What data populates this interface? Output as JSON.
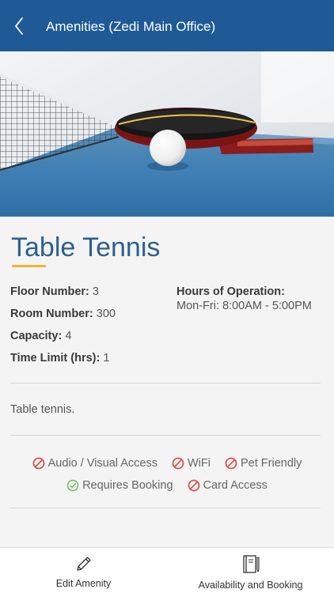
{
  "header": {
    "title": "Amenities (Zedi Main Office)",
    "back_icon": "chevron-left-icon",
    "color": "#1f5a96"
  },
  "hero": {
    "image": "table-tennis-paddle-and-ball-photo"
  },
  "amenity": {
    "name": "Table Tennis",
    "accent_color": "#f1b62b",
    "floor_label": "Floor Number:",
    "floor_value": "3",
    "room_label": "Room Number:",
    "room_value": "300",
    "capacity_label": "Capacity:",
    "capacity_value": "4",
    "time_limit_label": "Time Limit (hrs):",
    "time_limit_value": "1",
    "hours_label": "Hours of Operation:",
    "hours_value": "Mon-Fri: 8:00AM - 5:00PM",
    "description": "Table tennis."
  },
  "features": [
    {
      "label": "Audio / Visual Access",
      "available": false,
      "icon": "prohibited-icon"
    },
    {
      "label": "WiFi",
      "available": false,
      "icon": "prohibited-icon"
    },
    {
      "label": "Pet Friendly",
      "available": false,
      "icon": "prohibited-icon"
    },
    {
      "label": "Requires Booking",
      "available": true,
      "icon": "check-circle-icon"
    },
    {
      "label": "Card Access",
      "available": false,
      "icon": "prohibited-icon"
    }
  ],
  "feature_colors": {
    "unavailable": "#d9534f",
    "available": "#6fbf5a"
  },
  "bottom_tabs": [
    {
      "label": "Edit Amenity",
      "icon": "pencil-icon"
    },
    {
      "label": "Availability and Booking",
      "icon": "booking-book-icon"
    }
  ]
}
